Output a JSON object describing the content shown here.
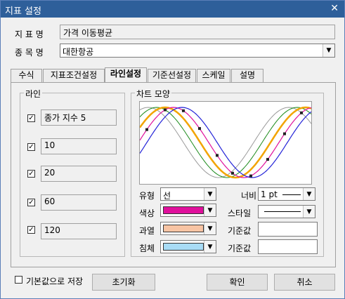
{
  "window": {
    "title": "지표 설정"
  },
  "header": {
    "indicator_label": "지 표 명",
    "indicator_value": "가격 이동평균",
    "stock_label": "종 목 명",
    "stock_value": "대한항공"
  },
  "tabs": [
    {
      "label": "수식"
    },
    {
      "label": "지표조건설정"
    },
    {
      "label": "라인설정",
      "active": true
    },
    {
      "label": "기준선설정"
    },
    {
      "label": "스케일"
    },
    {
      "label": "설명"
    }
  ],
  "lines": {
    "group_title": "라인",
    "items": [
      {
        "label": "종가 지수 5",
        "checked": true
      },
      {
        "label": "10",
        "checked": true
      },
      {
        "label": "20",
        "checked": true
      },
      {
        "label": "60",
        "checked": true
      },
      {
        "label": "120",
        "checked": true
      }
    ]
  },
  "chart_shape": {
    "group_title": "차트 모양",
    "type_label": "유형",
    "type_value": "선",
    "width_label": "너비",
    "width_value": "1 pt",
    "color_label": "색상",
    "color_value": "#e0109c",
    "style_label": "스타일",
    "over_label": "과열",
    "over_color": "#f7c4a4",
    "base1_label": "기준값",
    "base1_value": "",
    "under_label": "침체",
    "under_color": "#a8dcf6",
    "base2_label": "기준값",
    "base2_value": ""
  },
  "footer": {
    "save_default_label": "기본값으로 저장",
    "reset_label": "초기화",
    "ok_label": "확인",
    "cancel_label": "취소"
  },
  "colors": {
    "titlebar": "#2e5f9a",
    "wave_magenta": "#e0109c",
    "wave_blue": "#2424d8",
    "wave_orange": "#f2a400",
    "wave_green": "#1a8a1a",
    "wave_gray": "#9a9a9a"
  }
}
